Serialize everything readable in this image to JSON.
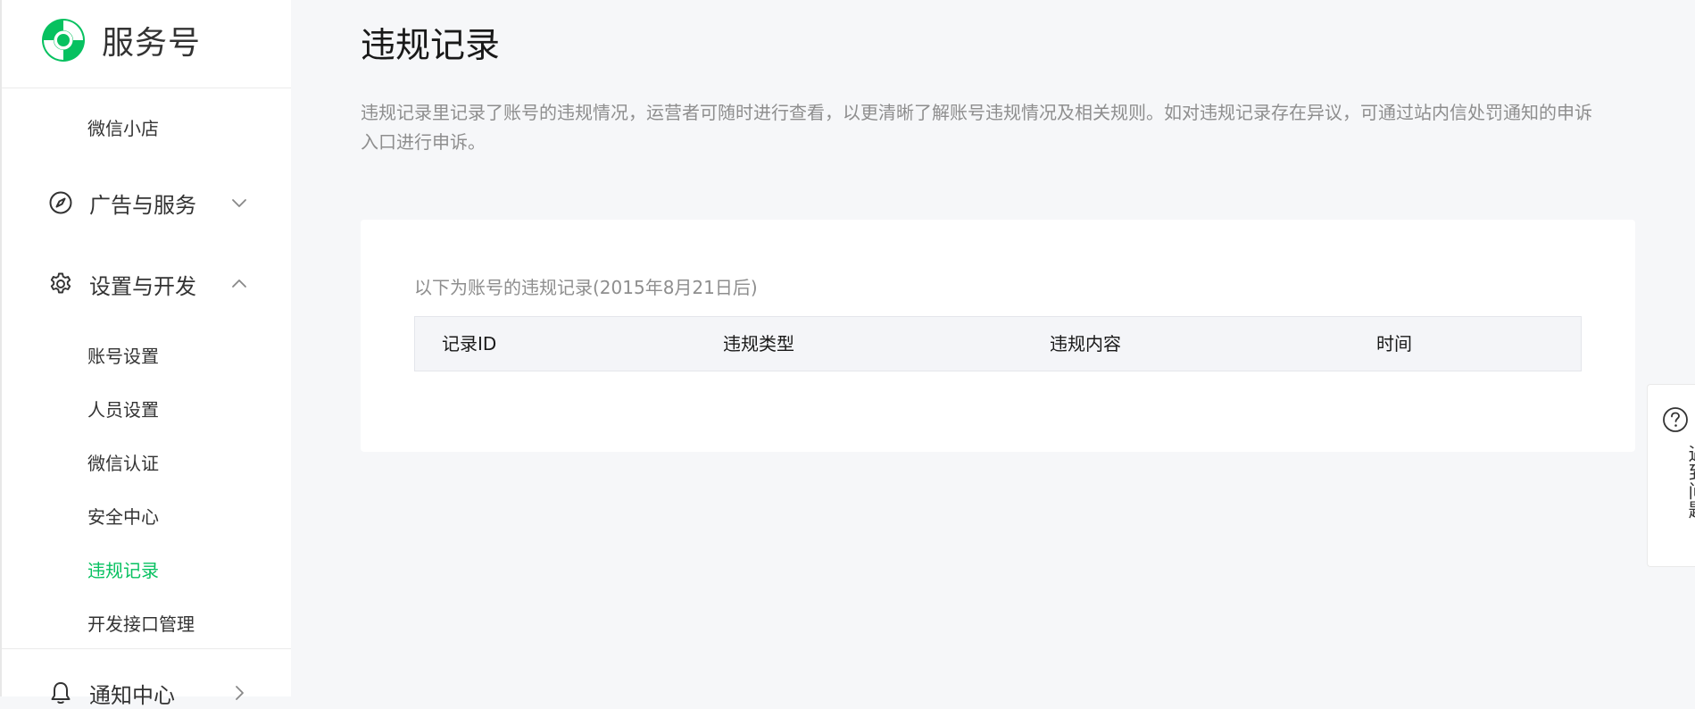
{
  "brand": {
    "name": "服务号",
    "accent_color": "#07c160"
  },
  "sidebar": {
    "items": [
      {
        "type": "sub",
        "label": "微信小店"
      },
      {
        "type": "group",
        "label": "广告与服务",
        "icon": "compass-icon",
        "expanded": false
      },
      {
        "type": "group",
        "label": "设置与开发",
        "icon": "gear-icon",
        "expanded": true
      },
      {
        "type": "sub",
        "label": "账号设置"
      },
      {
        "type": "sub",
        "label": "人员设置"
      },
      {
        "type": "sub",
        "label": "微信认证"
      },
      {
        "type": "sub",
        "label": "安全中心"
      },
      {
        "type": "sub",
        "label": "违规记录",
        "active": true
      },
      {
        "type": "sub",
        "label": "开发接口管理"
      },
      {
        "type": "group",
        "label": "通知中心",
        "icon": "bell-icon",
        "expanded": false
      }
    ]
  },
  "main": {
    "title": "违规记录",
    "description": "违规记录里记录了账号的违规情况，运营者可随时进行查看，以更清晰了解账号违规情况及相关规则。如对违规记录存在异议，可通过站内信处罚通知的申诉入口进行申诉。",
    "card": {
      "caption": "以下为账号的违规记录(2015年8月21日后)",
      "table": {
        "columns": [
          "记录ID",
          "违规类型",
          "违规内容",
          "时间"
        ],
        "rows": []
      }
    }
  },
  "help": {
    "label": "遇到问题",
    "icon": "question-circle-icon"
  }
}
